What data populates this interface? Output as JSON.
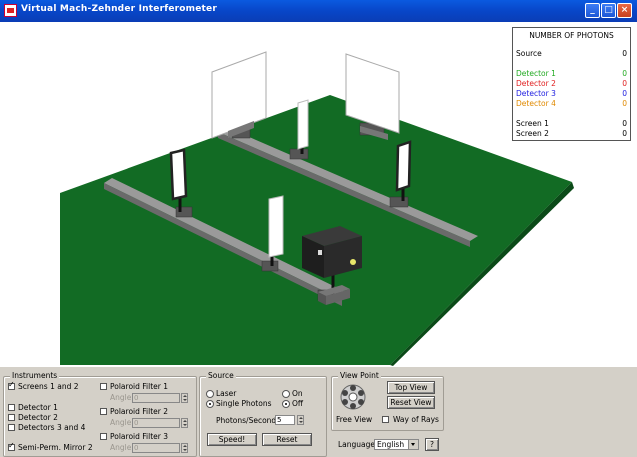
{
  "window": {
    "title": "Virtual Mach-Zehnder Interferometer",
    "minimize_label": "_",
    "maximize_label": "□",
    "close_label": "×"
  },
  "photon_panel": {
    "title": "NUMBER OF PHOTONS",
    "rows": [
      {
        "label": "Source",
        "value": "0",
        "color": "#000000"
      },
      {
        "label": "Detector 1",
        "value": "0",
        "color": "#22aa22"
      },
      {
        "label": "Detector 2",
        "value": "0",
        "color": "#e02020"
      },
      {
        "label": "Detector 3",
        "value": "0",
        "color": "#2020e0"
      },
      {
        "label": "Detector 4",
        "value": "0",
        "color": "#e08a00"
      },
      {
        "label": "Screen 1",
        "value": "0",
        "color": "#000000"
      },
      {
        "label": "Screen 2",
        "value": "0",
        "color": "#000000"
      }
    ]
  },
  "instruments": {
    "legend": "Instruments",
    "screens_1_and_2": "Screens 1 and 2",
    "detector_1": "Detector 1",
    "detector_2": "Detector 2",
    "detectors_3_and_4": "Detectors 3 and 4",
    "semi_perm_mirror_2": "Semi-Perm. Mirror 2",
    "polaroid_filter_1": "Polaroid Filter 1",
    "polaroid_filter_2": "Polaroid Filter 2",
    "polaroid_filter_3": "Polaroid Filter 3",
    "angle_label": "Angle",
    "angle_value": "0"
  },
  "source": {
    "legend": "Source",
    "laser": "Laser",
    "single_photons": "Single Photons",
    "on": "On",
    "off": "Off",
    "photons_per_second_label": "Photons/Second",
    "photons_per_second_value": "5",
    "speed_button": "Speed!",
    "reset_button": "Reset"
  },
  "view_point": {
    "legend": "View Point",
    "free_view": "Free View",
    "top_view": "Top View",
    "reset_view": "Reset View",
    "way_of_rays": "Way of Rays",
    "language_label": "Language",
    "language_value": "English",
    "help_button": "?"
  },
  "colors": {
    "table_green": "#126b24",
    "rail_gray": "#8a8a8a",
    "title_blue": "#0a5ae0"
  }
}
